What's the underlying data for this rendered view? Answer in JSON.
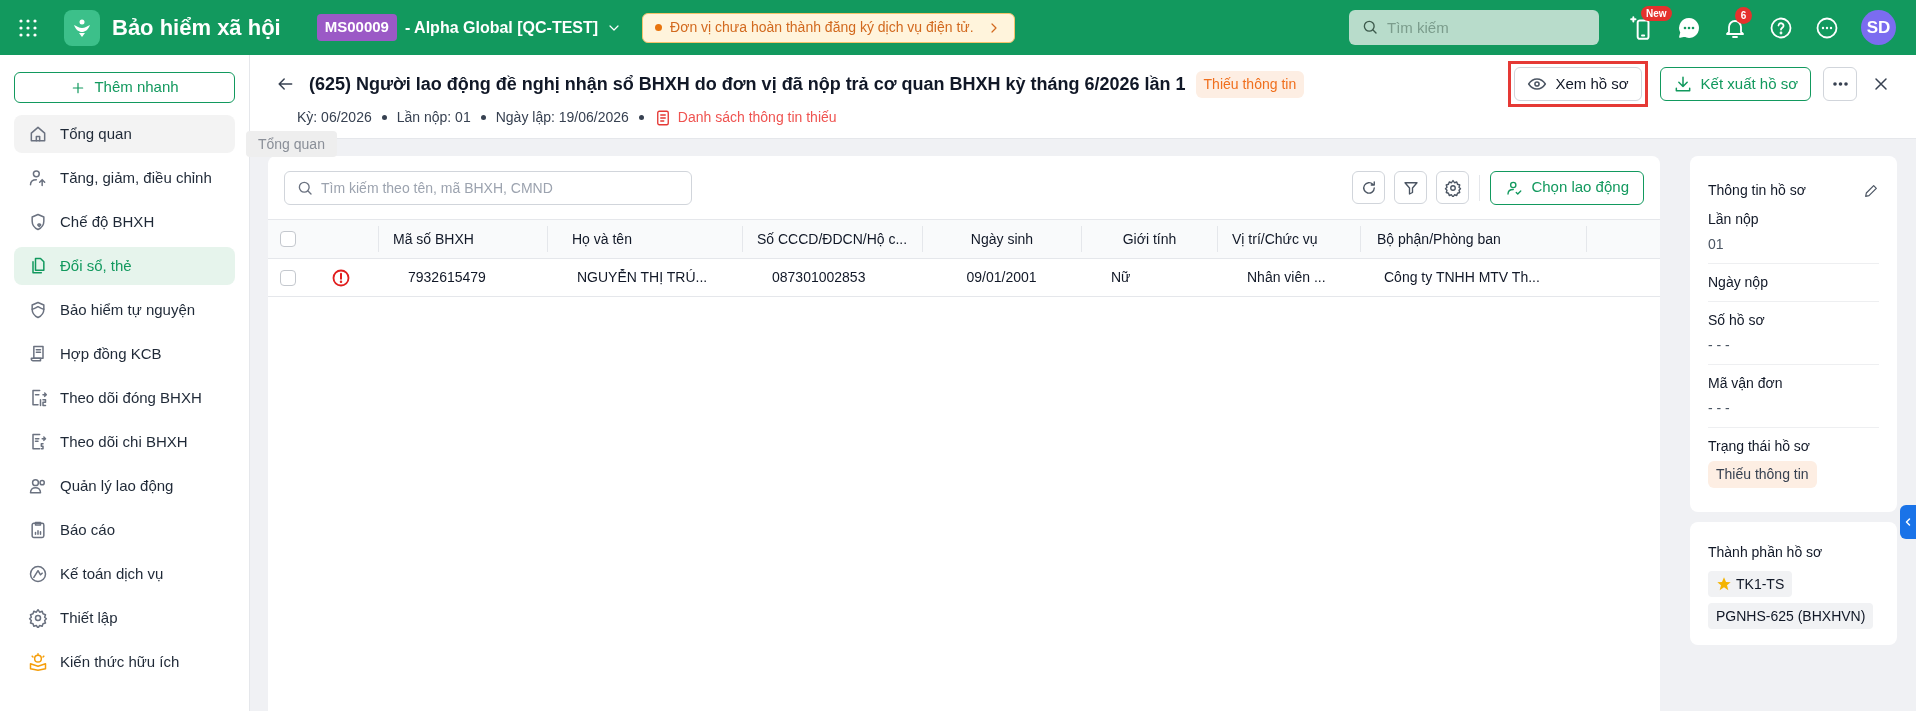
{
  "topbar": {
    "app_title": "Bảo hiểm xã hội",
    "org_code": "MS00009",
    "org_name": "- Alpha Global [QC-TEST]",
    "notice": "Đơn vị chưa hoàn thành đăng ký dịch vụ điện tử.",
    "search_placeholder": "Tìm kiếm",
    "new_badge": "New",
    "notification_count": "6",
    "avatar": "SD"
  },
  "sidebar": {
    "quick_add": "Thêm nhanh",
    "items": [
      {
        "label": "Tổng quan",
        "selected": false,
        "hovered": true
      },
      {
        "label": "Tăng, giảm, điều chỉnh",
        "selected": false,
        "hovered": false
      },
      {
        "label": "Chế độ BHXH",
        "selected": false,
        "hovered": false
      },
      {
        "label": "Đổi sổ, thẻ",
        "selected": true,
        "hovered": false
      },
      {
        "label": "Bảo hiểm tự nguyện",
        "selected": false,
        "hovered": false
      },
      {
        "label": "Hợp đồng KCB",
        "selected": false,
        "hovered": false
      },
      {
        "label": "Theo dõi đóng BHXH",
        "selected": false,
        "hovered": false
      },
      {
        "label": "Theo dõi chi BHXH",
        "selected": false,
        "hovered": false
      },
      {
        "label": "Quản lý lao động",
        "selected": false,
        "hovered": false
      },
      {
        "label": "Báo cáo",
        "selected": false,
        "hovered": false
      },
      {
        "label": "Kế toán dịch vụ",
        "selected": false,
        "hovered": false
      },
      {
        "label": "Thiết lập",
        "selected": false,
        "hovered": false
      },
      {
        "label": "Kiến thức hữu ích",
        "selected": false,
        "hovered": false
      }
    ],
    "tooltip": "Tổng quan"
  },
  "header": {
    "title": "(625) Người lao động đề nghị nhận sổ BHXH do đơn vị đã nộp trả cơ quan BHXH kỳ tháng 6/2026 lần 1",
    "status": "Thiếu thông tin",
    "meta": [
      "Kỳ: 06/2026",
      "Lần nộp: 01",
      "Ngày lập: 19/06/2026"
    ],
    "missing_link": "Danh sách thông tin thiếu",
    "buttons": [
      {
        "kind": "view",
        "label": "Xem hồ sơ",
        "highlighted": true
      },
      {
        "kind": "export",
        "label": "Kết xuất hồ sơ",
        "highlighted": false
      }
    ]
  },
  "table": {
    "search_placeholder": "Tìm kiếm theo tên, mã BHXH, CMND",
    "select_button": "Chọn lao động",
    "all_checked": false,
    "columns": [
      "Mã số BHXH",
      "Họ và tên",
      "Số CCCD/ĐDCN/Hộ c...",
      "Ngày sinh",
      "Giới tính",
      "Vị trí/Chức vụ",
      "Bộ phận/Phòng ban"
    ],
    "rows": [
      {
        "checked": false,
        "warning": true,
        "cells": [
          "7932615479",
          "NGUYỄN THỊ TRÚ...",
          "087301002853",
          "09/01/2001",
          "Nữ",
          "Nhân viên ...",
          "Công ty TNHH MTV Th..."
        ]
      }
    ]
  },
  "info_panel": {
    "title": "Thông tin hồ sơ",
    "fields": [
      {
        "label": "Lần nộp",
        "value": "01"
      },
      {
        "label": "Ngày nộp"
      },
      {
        "label": "Số hồ sơ",
        "value": "- - -"
      },
      {
        "label": "Mã vận đơn",
        "value": "- - -"
      }
    ],
    "status_label": "Trạng thái hồ sơ",
    "status": "Thiếu thông tin"
  },
  "components": {
    "title": "Thành phần hồ sơ",
    "items": [
      {
        "label": "TK1-TS",
        "starred": true
      },
      {
        "label": "PGNHS-625 (BHXHVN)",
        "starred": false
      }
    ]
  }
}
